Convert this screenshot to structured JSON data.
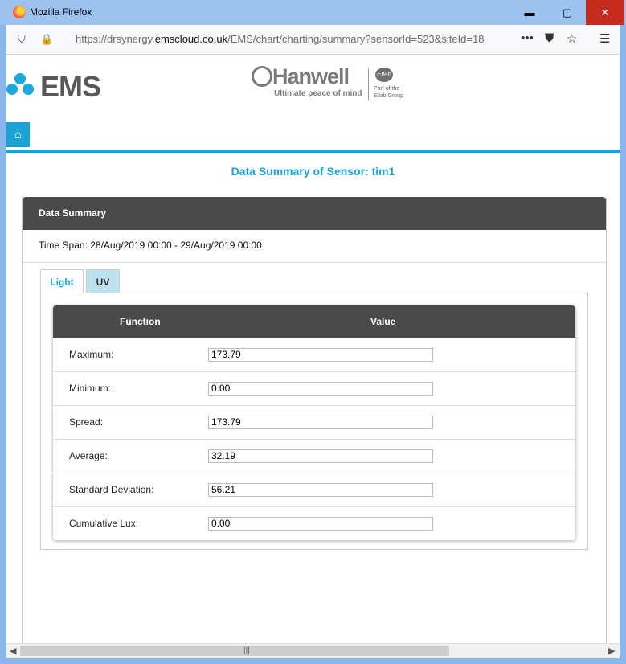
{
  "window": {
    "title": "Mozilla Firefox",
    "minimize": "▬",
    "maximize": "▢",
    "close": "✕"
  },
  "browser": {
    "url_prefix": "https://drsynergy.",
    "url_domain": "emscloud.co.uk",
    "url_suffix": "/EMS/chart/charting/summary?sensorId=523&siteId=18",
    "more": "•••",
    "menu": "☰"
  },
  "logos": {
    "ems": "EMS",
    "hanwell_name": "Hanwell",
    "hanwell_tag": "Ultimate peace of mind",
    "part_of": "Part of the",
    "group": "Ellab Group",
    "ellab": "Ellab"
  },
  "page": {
    "heading": "Data Summary of Sensor: tim1",
    "panel_title": "Data Summary",
    "time_span": "Time Span: 28/Aug/2019 00:00 - 29/Aug/2019 00:00"
  },
  "tabs": [
    {
      "label": "Light",
      "active": true
    },
    {
      "label": "UV",
      "active": false
    }
  ],
  "table": {
    "headers": {
      "function": "Function",
      "value": "Value"
    },
    "rows": [
      {
        "label": "Maximum:",
        "value": "173.79"
      },
      {
        "label": "Minimum:",
        "value": "0.00"
      },
      {
        "label": "Spread:",
        "value": "173.79"
      },
      {
        "label": "Average:",
        "value": "32.19"
      },
      {
        "label": "Standard Deviation:",
        "value": "56.21"
      },
      {
        "label": "Cumulative Lux:",
        "value": "0.00"
      }
    ]
  },
  "colors": {
    "accent": "#1aa3d4",
    "header_dark": "#4a4a4a",
    "tab_inactive": "#bfe1ef"
  }
}
